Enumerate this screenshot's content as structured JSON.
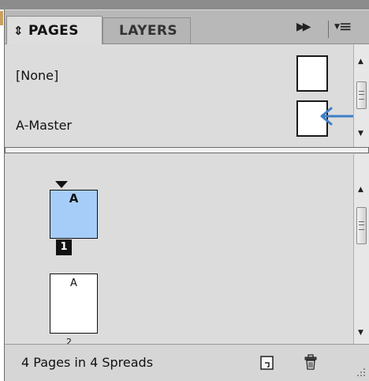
{
  "panel": {
    "tabs": [
      {
        "label": "PAGES",
        "active": true
      },
      {
        "label": "LAYERS",
        "active": false
      }
    ],
    "icons": {
      "sort": "updown-icon",
      "collapse": "double-chevron-right-icon",
      "menu": "panel-menu-icon"
    }
  },
  "masters": [
    {
      "label": "[None]"
    },
    {
      "label": "A-Master"
    }
  ],
  "pages": [
    {
      "prefix": "A",
      "number": "1",
      "selected": true
    },
    {
      "prefix": "A",
      "number": "2",
      "selected": false
    }
  ],
  "status": {
    "text": "4 Pages in 4 Spreads"
  },
  "colors": {
    "selected_page_fill": "#a6cdf7",
    "annotation_arrow": "#3f7ec6"
  }
}
